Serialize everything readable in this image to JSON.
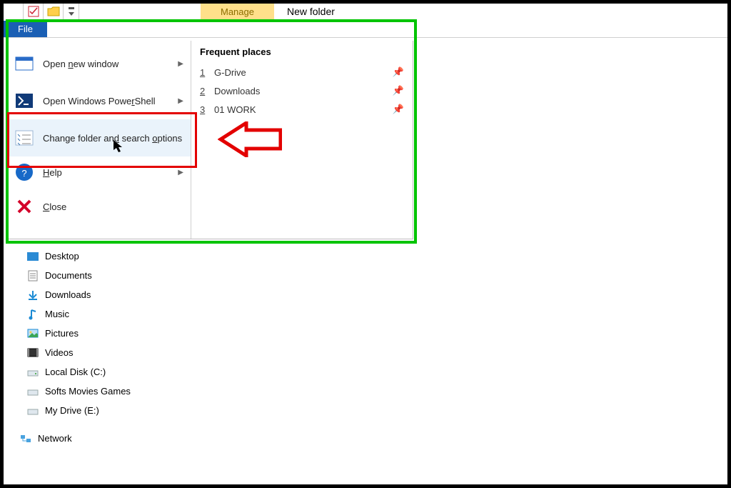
{
  "title_strip": {
    "manage_label": "Manage",
    "window_title": "New folder"
  },
  "tabs": {
    "file_label": "File"
  },
  "file_menu": {
    "open_new_window": "Open new window",
    "open_powershell": "Open Windows PowerShell",
    "change_options": "Change folder and search options",
    "help": "Help",
    "close": "Close"
  },
  "frequent_places": {
    "heading": "Frequent places",
    "items": [
      {
        "num": "1",
        "name": "G-Drive"
      },
      {
        "num": "2",
        "name": "Downloads"
      },
      {
        "num": "3",
        "name": "01 WORK"
      }
    ]
  },
  "tree": {
    "desktop": "Desktop",
    "documents": "Documents",
    "downloads": "Downloads",
    "music": "Music",
    "pictures": "Pictures",
    "videos": "Videos",
    "local_c": "Local Disk (C:)",
    "softs": "Softs Movies Games",
    "mydrive": "My Drive (E:)",
    "network": "Network"
  }
}
